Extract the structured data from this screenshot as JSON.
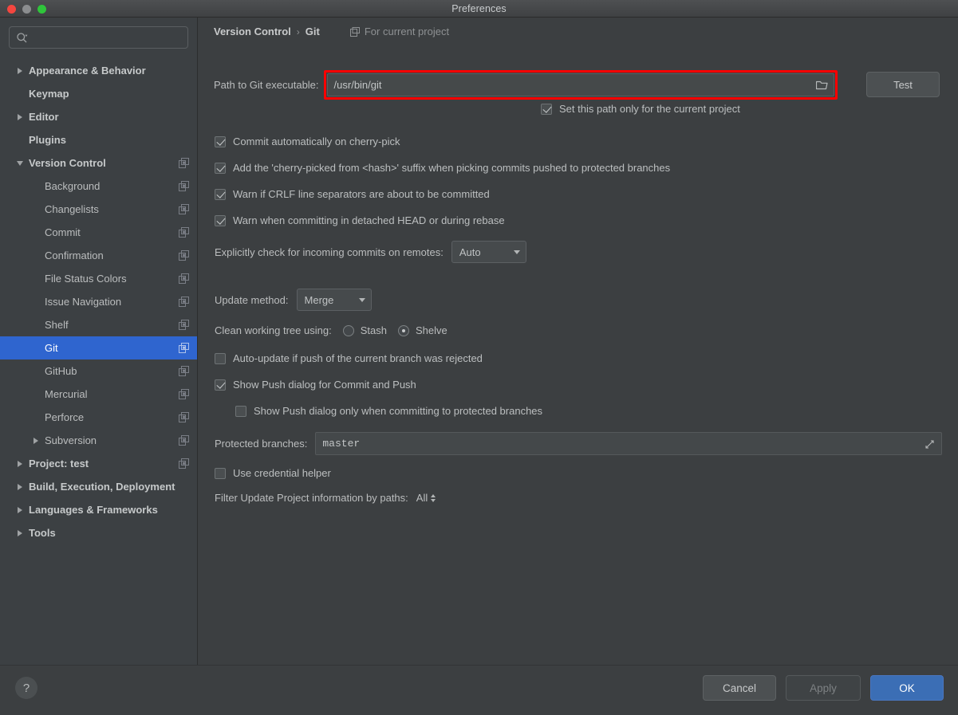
{
  "window": {
    "title": "Preferences",
    "traffic_lights": [
      "close-red",
      "minimize-gray",
      "zoom-green"
    ]
  },
  "sidebar": {
    "search": {
      "value": "",
      "placeholder": ""
    },
    "items": [
      {
        "label": "Appearance & Behavior",
        "depth": 0,
        "arrow": "right",
        "bold": true,
        "copy": false,
        "selected": false
      },
      {
        "label": "Keymap",
        "depth": 0,
        "arrow": "none",
        "bold": true,
        "copy": false,
        "selected": false
      },
      {
        "label": "Editor",
        "depth": 0,
        "arrow": "right",
        "bold": true,
        "copy": false,
        "selected": false
      },
      {
        "label": "Plugins",
        "depth": 0,
        "arrow": "none",
        "bold": true,
        "copy": false,
        "selected": false
      },
      {
        "label": "Version Control",
        "depth": 0,
        "arrow": "down",
        "bold": true,
        "copy": true,
        "selected": false
      },
      {
        "label": "Background",
        "depth": 1,
        "arrow": "none",
        "bold": false,
        "copy": true,
        "selected": false
      },
      {
        "label": "Changelists",
        "depth": 1,
        "arrow": "none",
        "bold": false,
        "copy": true,
        "selected": false
      },
      {
        "label": "Commit",
        "depth": 1,
        "arrow": "none",
        "bold": false,
        "copy": true,
        "selected": false
      },
      {
        "label": "Confirmation",
        "depth": 1,
        "arrow": "none",
        "bold": false,
        "copy": true,
        "selected": false
      },
      {
        "label": "File Status Colors",
        "depth": 1,
        "arrow": "none",
        "bold": false,
        "copy": true,
        "selected": false
      },
      {
        "label": "Issue Navigation",
        "depth": 1,
        "arrow": "none",
        "bold": false,
        "copy": true,
        "selected": false
      },
      {
        "label": "Shelf",
        "depth": 1,
        "arrow": "none",
        "bold": false,
        "copy": true,
        "selected": false
      },
      {
        "label": "Git",
        "depth": 1,
        "arrow": "none",
        "bold": false,
        "copy": true,
        "selected": true
      },
      {
        "label": "GitHub",
        "depth": 1,
        "arrow": "none",
        "bold": false,
        "copy": true,
        "selected": false
      },
      {
        "label": "Mercurial",
        "depth": 1,
        "arrow": "none",
        "bold": false,
        "copy": true,
        "selected": false
      },
      {
        "label": "Perforce",
        "depth": 1,
        "arrow": "none",
        "bold": false,
        "copy": true,
        "selected": false
      },
      {
        "label": "Subversion",
        "depth": 1,
        "arrow": "right",
        "bold": false,
        "copy": true,
        "selected": false
      },
      {
        "label": "Project: test",
        "depth": 0,
        "arrow": "right",
        "bold": true,
        "copy": true,
        "selected": false
      },
      {
        "label": "Build, Execution, Deployment",
        "depth": 0,
        "arrow": "right",
        "bold": true,
        "copy": false,
        "selected": false
      },
      {
        "label": "Languages & Frameworks",
        "depth": 0,
        "arrow": "right",
        "bold": true,
        "copy": false,
        "selected": false
      },
      {
        "label": "Tools",
        "depth": 0,
        "arrow": "right",
        "bold": true,
        "copy": false,
        "selected": false
      }
    ]
  },
  "content": {
    "breadcrumb": {
      "parent": "Version Control",
      "separator": "›",
      "current": "Git",
      "scope": "For current project"
    },
    "path": {
      "label": "Path to Git executable:",
      "value": "/usr/bin/git",
      "test_button": "Test",
      "highlighted": true,
      "highlight_color": "#fe0000"
    },
    "set_path_only": {
      "label": "Set this path only for the current project",
      "checked": true
    },
    "checkboxes": [
      {
        "label": "Commit automatically on cherry-pick",
        "checked": true
      },
      {
        "label": "Add the 'cherry-picked from <hash>' suffix when picking commits pushed to protected branches",
        "checked": true
      },
      {
        "label": "Warn if CRLF line separators are about to be committed",
        "checked": true
      },
      {
        "label": "Warn when committing in detached HEAD or during rebase",
        "checked": true
      }
    ],
    "incoming": {
      "label": "Explicitly check for incoming commits on remotes:",
      "value": "Auto"
    },
    "update_method": {
      "label": "Update method:",
      "value": "Merge"
    },
    "clean_tree": {
      "label": "Clean working tree using:",
      "options": [
        "Stash",
        "Shelve"
      ],
      "selected": "Shelve"
    },
    "auto_update": {
      "label": "Auto-update if push of the current branch was rejected",
      "checked": false
    },
    "show_push": {
      "label": "Show Push dialog for Commit and Push",
      "checked": true
    },
    "show_push_protected": {
      "label": "Show Push dialog only when committing to protected branches",
      "checked": false
    },
    "protected_branches": {
      "label": "Protected branches:",
      "value": "master"
    },
    "credential_helper": {
      "label": "Use credential helper",
      "checked": false
    },
    "filter_update": {
      "label": "Filter Update Project information by paths:",
      "value": "All"
    }
  },
  "footer": {
    "help": "?",
    "cancel": "Cancel",
    "apply": "Apply",
    "ok": "OK"
  },
  "colors": {
    "window_bg": "#3c3f41",
    "sidebar_bg": "#3c4043",
    "selection": "#2f65cf",
    "accent_button": "#3b6eb5",
    "highlight": "#fe0000",
    "text": "#bbbdbe"
  }
}
